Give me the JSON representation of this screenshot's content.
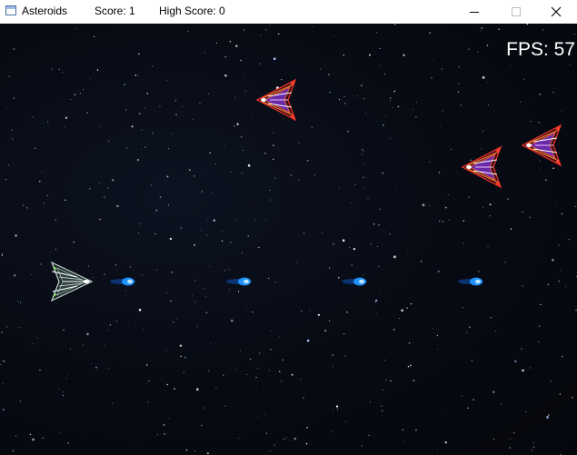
{
  "window": {
    "app_title": "Asteroids",
    "score_text": "Score: 1",
    "high_score_text": "High Score: 0",
    "controls": [
      "minimize",
      "maximize",
      "close"
    ]
  },
  "game": {
    "fps_text": "FPS: 57",
    "player_ship": "white-fighter-ship",
    "enemy_ships": [
      "red-enemy-ship",
      "red-enemy-ship",
      "red-enemy-ship"
    ],
    "projectiles": [
      "blue-plasma-bolt",
      "blue-plasma-bolt",
      "blue-plasma-bolt",
      "blue-plasma-bolt"
    ],
    "colors": {
      "background": "#070a12",
      "enemy": "#e0322a",
      "enemy_core": "#6a2aa8",
      "bolt": "#1e90ff",
      "player": "#d8e4e4"
    }
  }
}
